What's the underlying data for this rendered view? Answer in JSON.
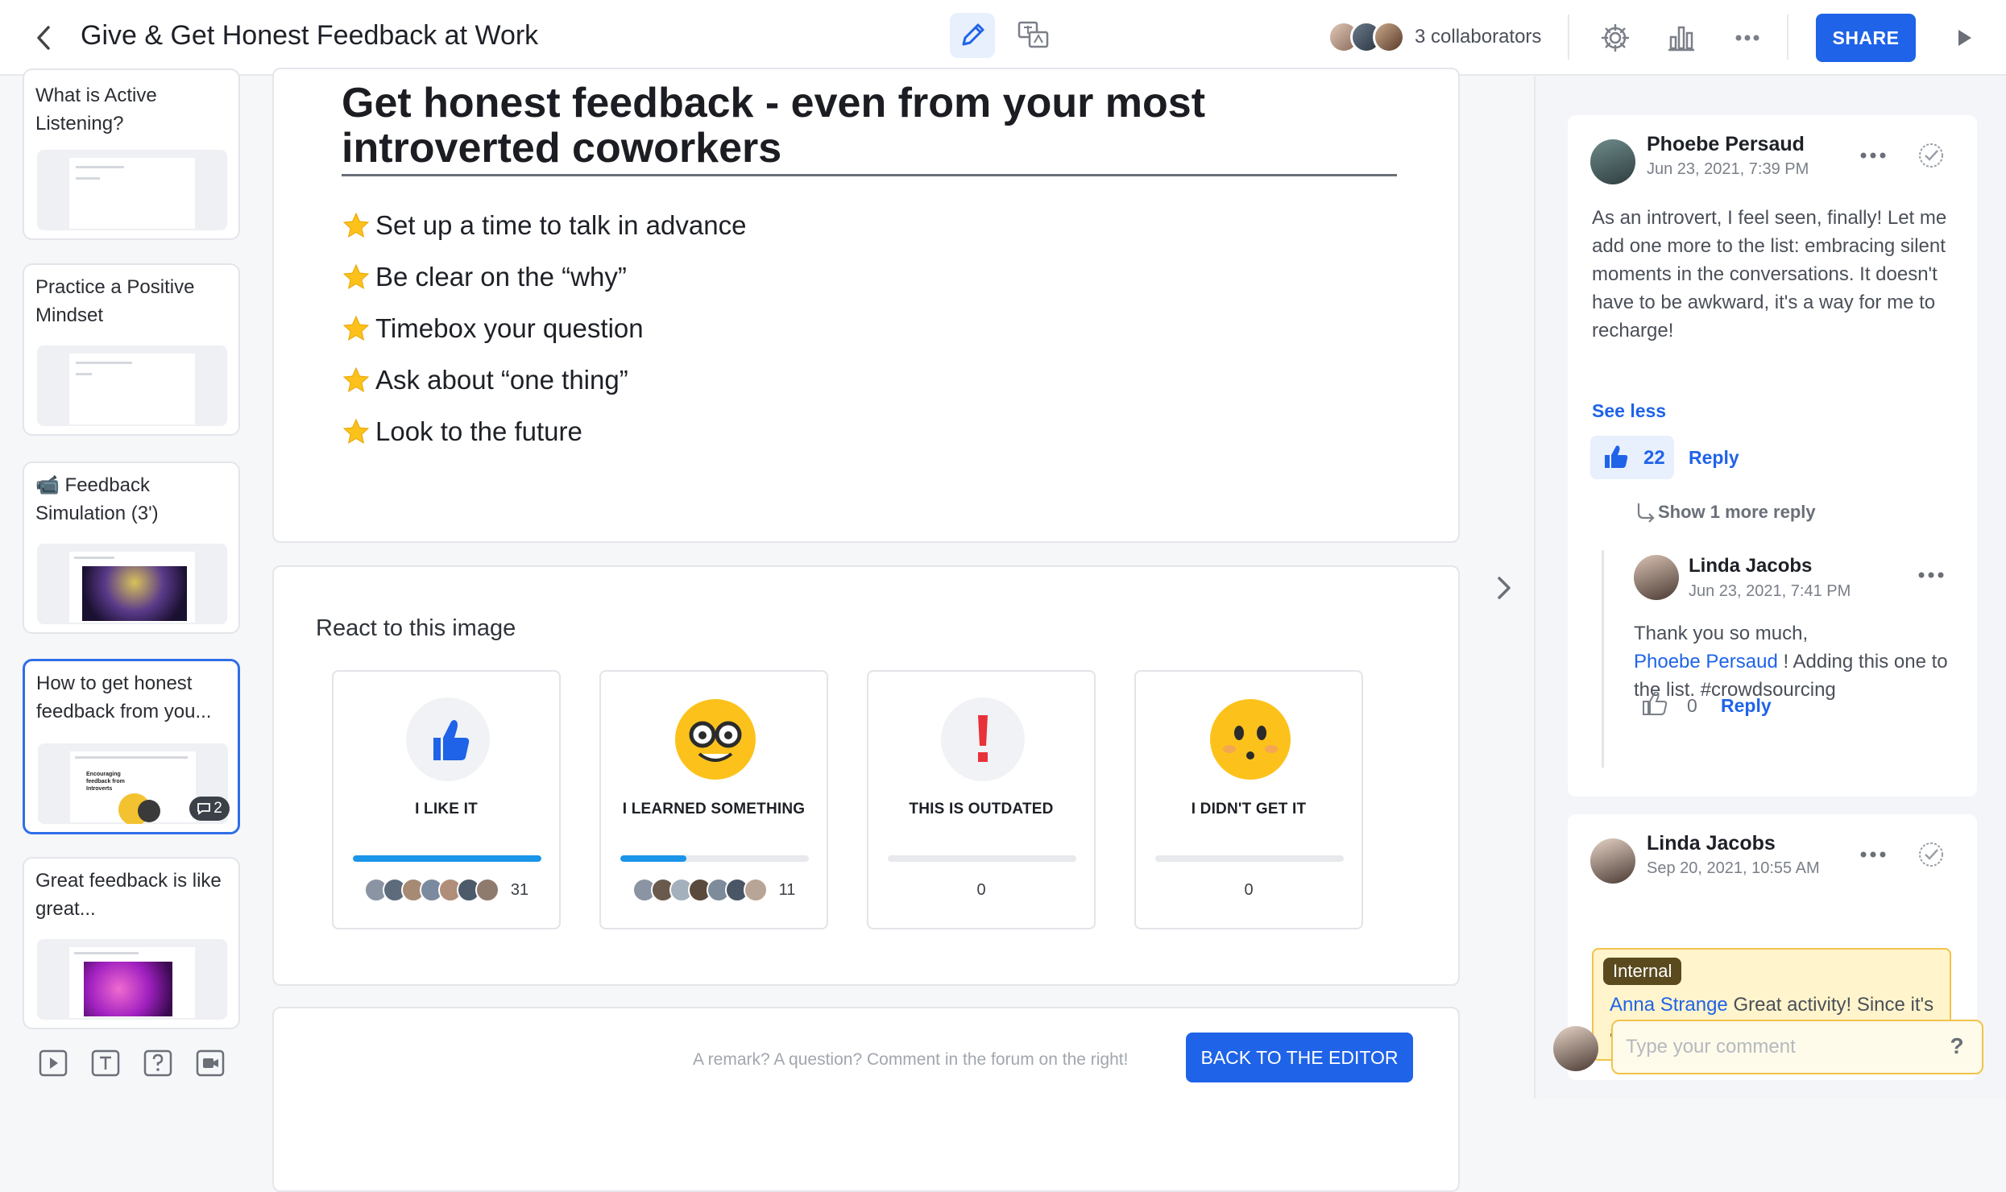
{
  "header": {
    "title": "Give & Get Honest Feedback at Work",
    "collaborators_label": "3 collaborators",
    "share_label": "SHARE"
  },
  "sidebar": {
    "slides": [
      {
        "title": "What is Active Listening?",
        "thumb": "What is active listening?"
      },
      {
        "title": "Practice a Positive Mindset",
        "thumb": "Practice a Positive Mindset"
      },
      {
        "title": "📹 Feedback Simulation (3')",
        "thumb": "Feedback simulation (3')"
      },
      {
        "title": "How to get honest feedback from you...",
        "thumb": "Encouraging feedback from Introverts",
        "comments": "2"
      },
      {
        "title": "Great feedback is like great...",
        "thumb": "Great feedback is like great"
      }
    ]
  },
  "slide": {
    "heading": "Get honest feedback - even from your most introverted coworkers",
    "bullets": [
      "Set up a time to talk in advance",
      "Be clear on the “why”",
      "Timebox your question",
      "Ask about “one thing”",
      "Look to the future"
    ]
  },
  "reactions": {
    "title": "React to this image",
    "items": [
      {
        "label": "I LIKE IT",
        "count": "31",
        "fill": 1.0
      },
      {
        "label": "I LEARNED SOMETHING",
        "count": "11",
        "fill": 0.35
      },
      {
        "label": "THIS IS OUTDATED",
        "count": "0",
        "fill": 0
      },
      {
        "label": "I DIDN'T GET IT",
        "count": "0",
        "fill": 0
      }
    ]
  },
  "footer": {
    "remark": "A remark? A question? Comment in the forum on the right!",
    "back_label": "BACK TO THE EDITOR"
  },
  "comments": {
    "c1": {
      "name": "Phoebe Persaud",
      "date": "Jun 23, 2021, 7:39 PM",
      "body": "As an introvert, I feel seen, finally! Let me add one more to the list: embracing silent moments in the conversations. It doesn't have to be awkward, it's a way for me to recharge!",
      "see_less": "See less",
      "likes": "22",
      "reply": "Reply",
      "show_more": "Show 1 more reply"
    },
    "r1": {
      "name": "Linda Jacobs",
      "date": "Jun 23, 2021, 7:41 PM",
      "body_pre": "Thank you so much,",
      "mention": "Phoebe Persaud",
      "body_post": "! Adding this one to the list. #crowdsourcing",
      "likes": "0",
      "reply": "Reply"
    },
    "c2": {
      "name": "Linda Jacobs",
      "date": "Sep 20, 2021, 10:55 AM",
      "tag": "Internal",
      "mention": "Anna Strange",
      "body": "Great activity! Since it's a tricky one, I suggest adding"
    },
    "input_placeholder": "Type your comment",
    "help": "?"
  },
  "colors": {
    "accent": "#1f63e8",
    "bar": "#1a95e8",
    "internal": "#fff4cc"
  }
}
